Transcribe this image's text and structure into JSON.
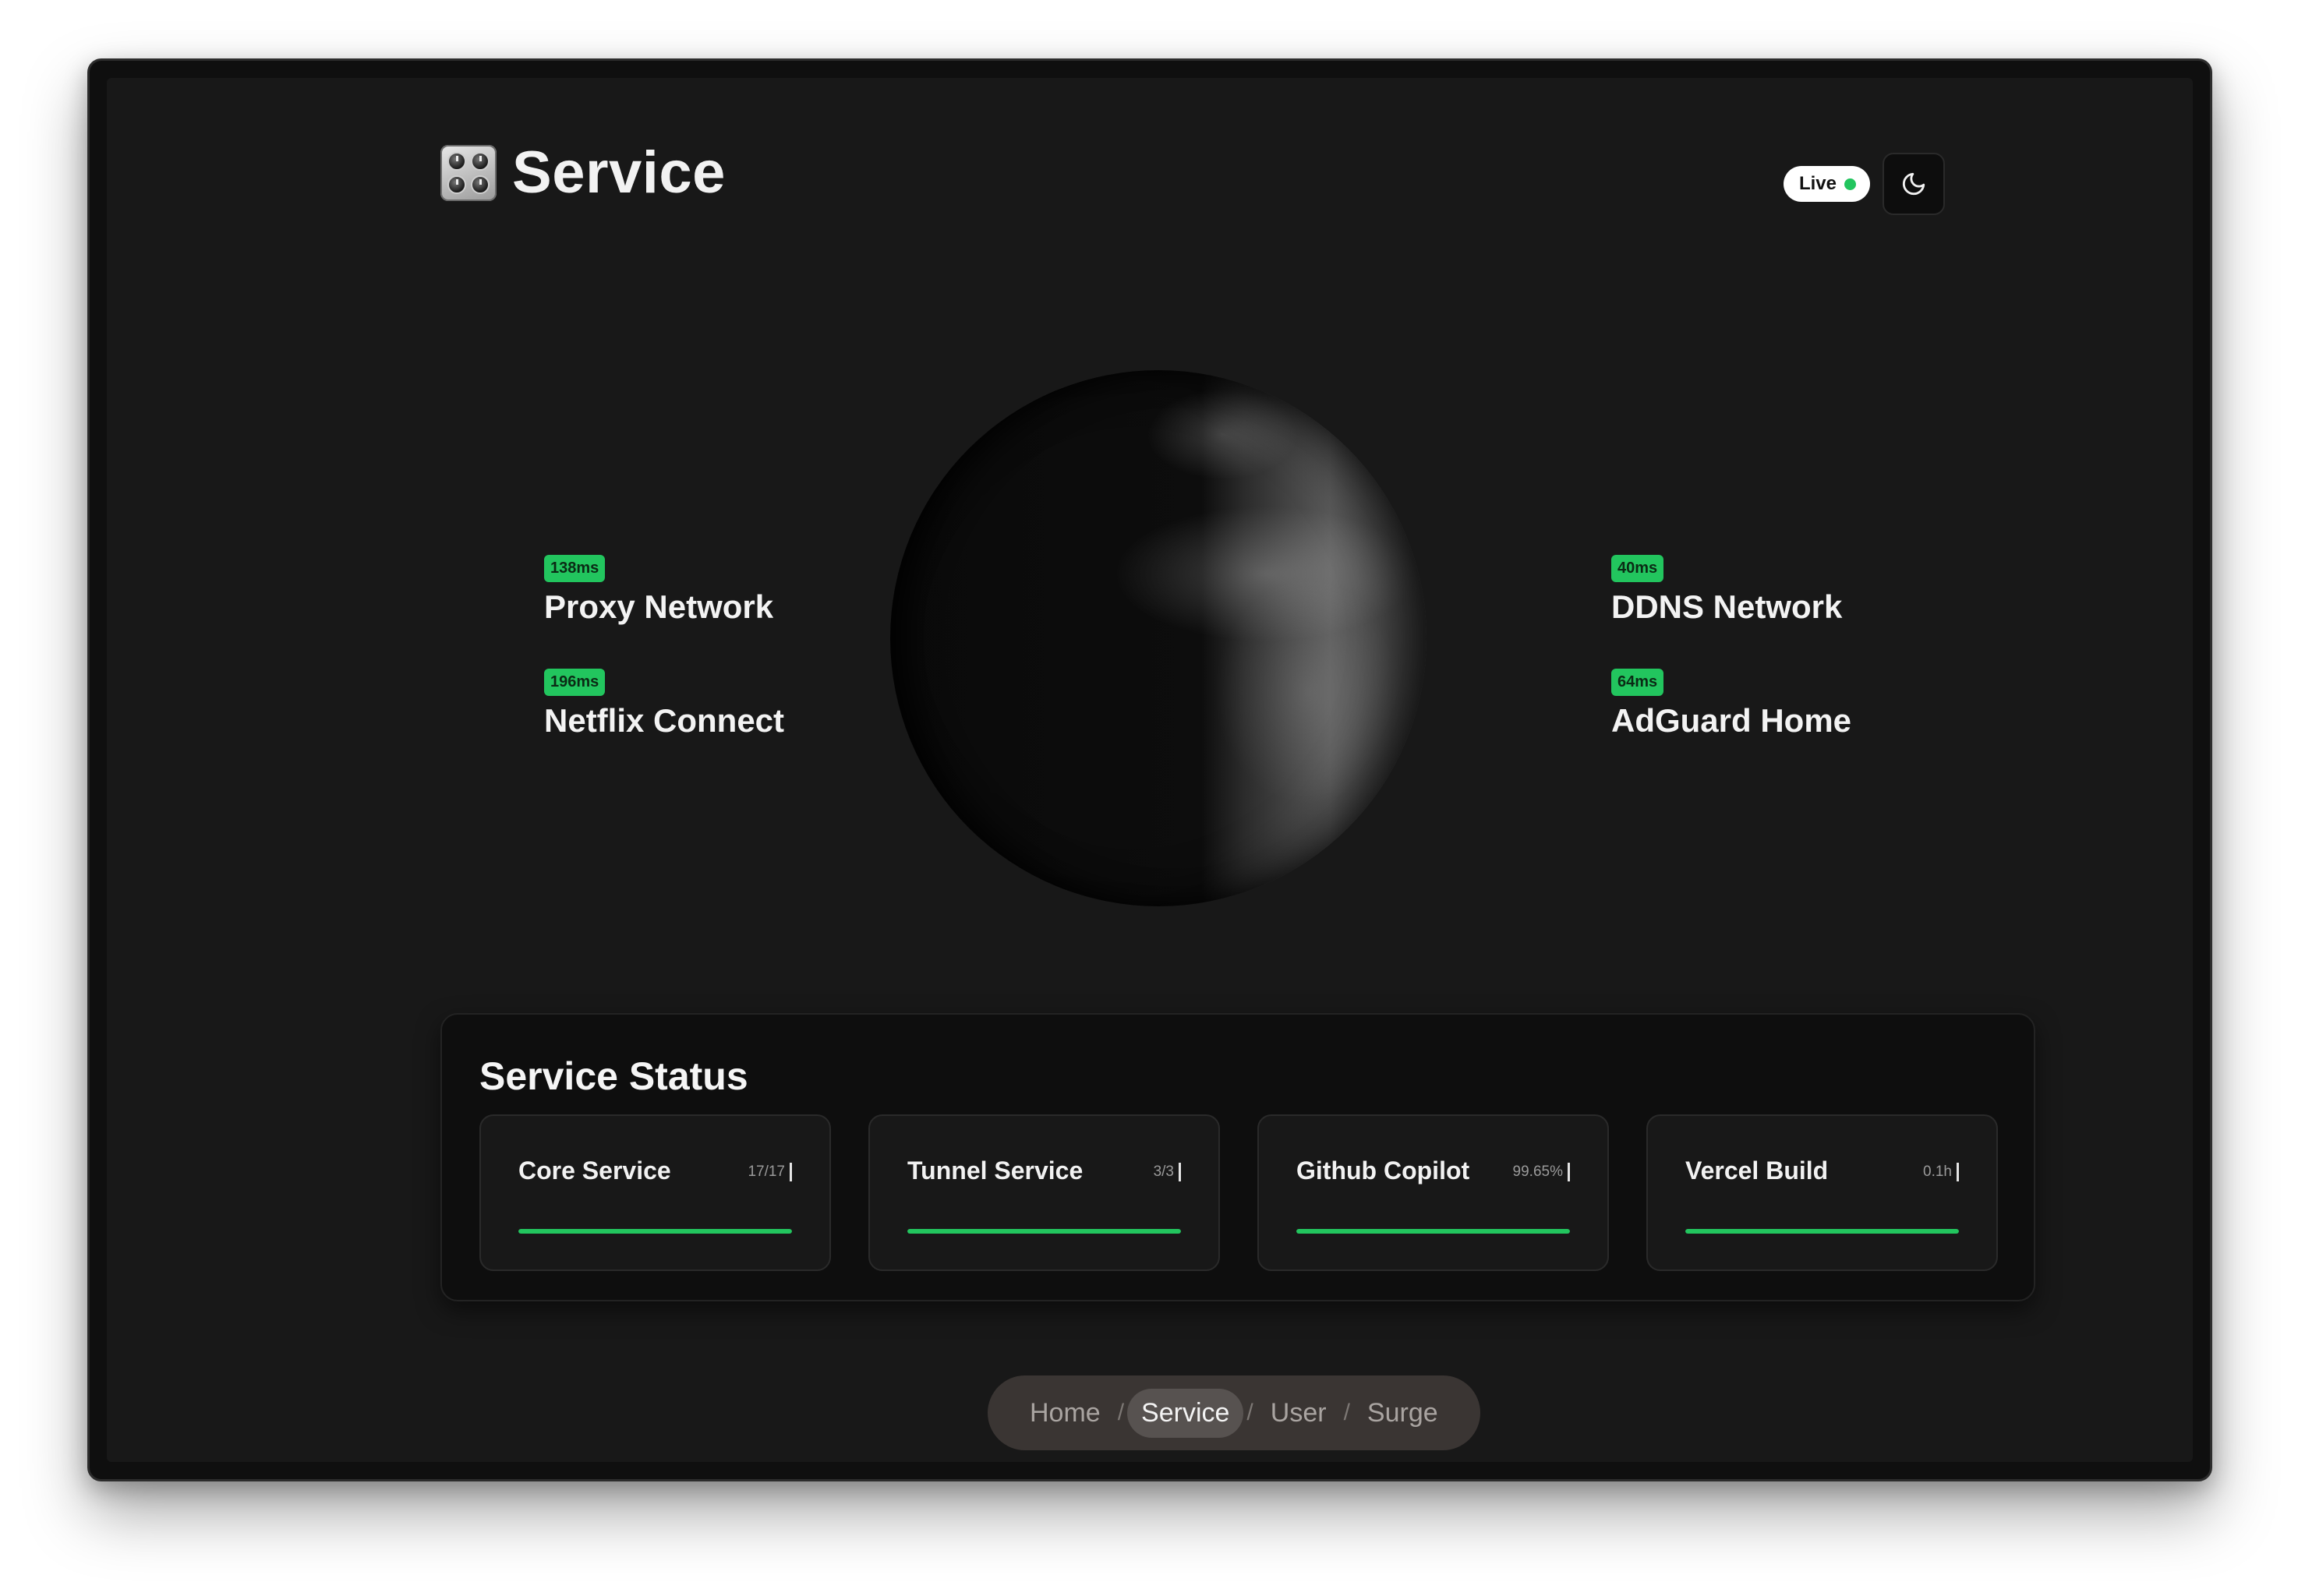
{
  "header": {
    "title": "Service",
    "live_label": "Live",
    "brand_icon": "control-knobs-icon",
    "theme_icon": "moon-icon"
  },
  "colors": {
    "accent": "#22c55e",
    "background": "#181818",
    "panel": "#0e0e0e"
  },
  "nodes": {
    "left": [
      {
        "latency": "138ms",
        "name": "Proxy Network"
      },
      {
        "latency": "196ms",
        "name": "Netflix Connect"
      }
    ],
    "right": [
      {
        "latency": "40ms",
        "name": "DDNS Network"
      },
      {
        "latency": "64ms",
        "name": "AdGuard Home"
      }
    ]
  },
  "status": {
    "title": "Service Status",
    "cards": [
      {
        "name": "Core Service",
        "meta": "17/17",
        "progress": 1.0
      },
      {
        "name": "Tunnel Service",
        "meta": "3/3",
        "progress": 1.0
      },
      {
        "name": "Github Copilot",
        "meta": "99.65%",
        "progress": 1.0
      },
      {
        "name": "Vercel Build",
        "meta": "0.1h",
        "progress": 1.0
      }
    ]
  },
  "nav": {
    "items": [
      "Home",
      "Service",
      "User",
      "Surge"
    ],
    "separator": "/",
    "active": "Service"
  }
}
